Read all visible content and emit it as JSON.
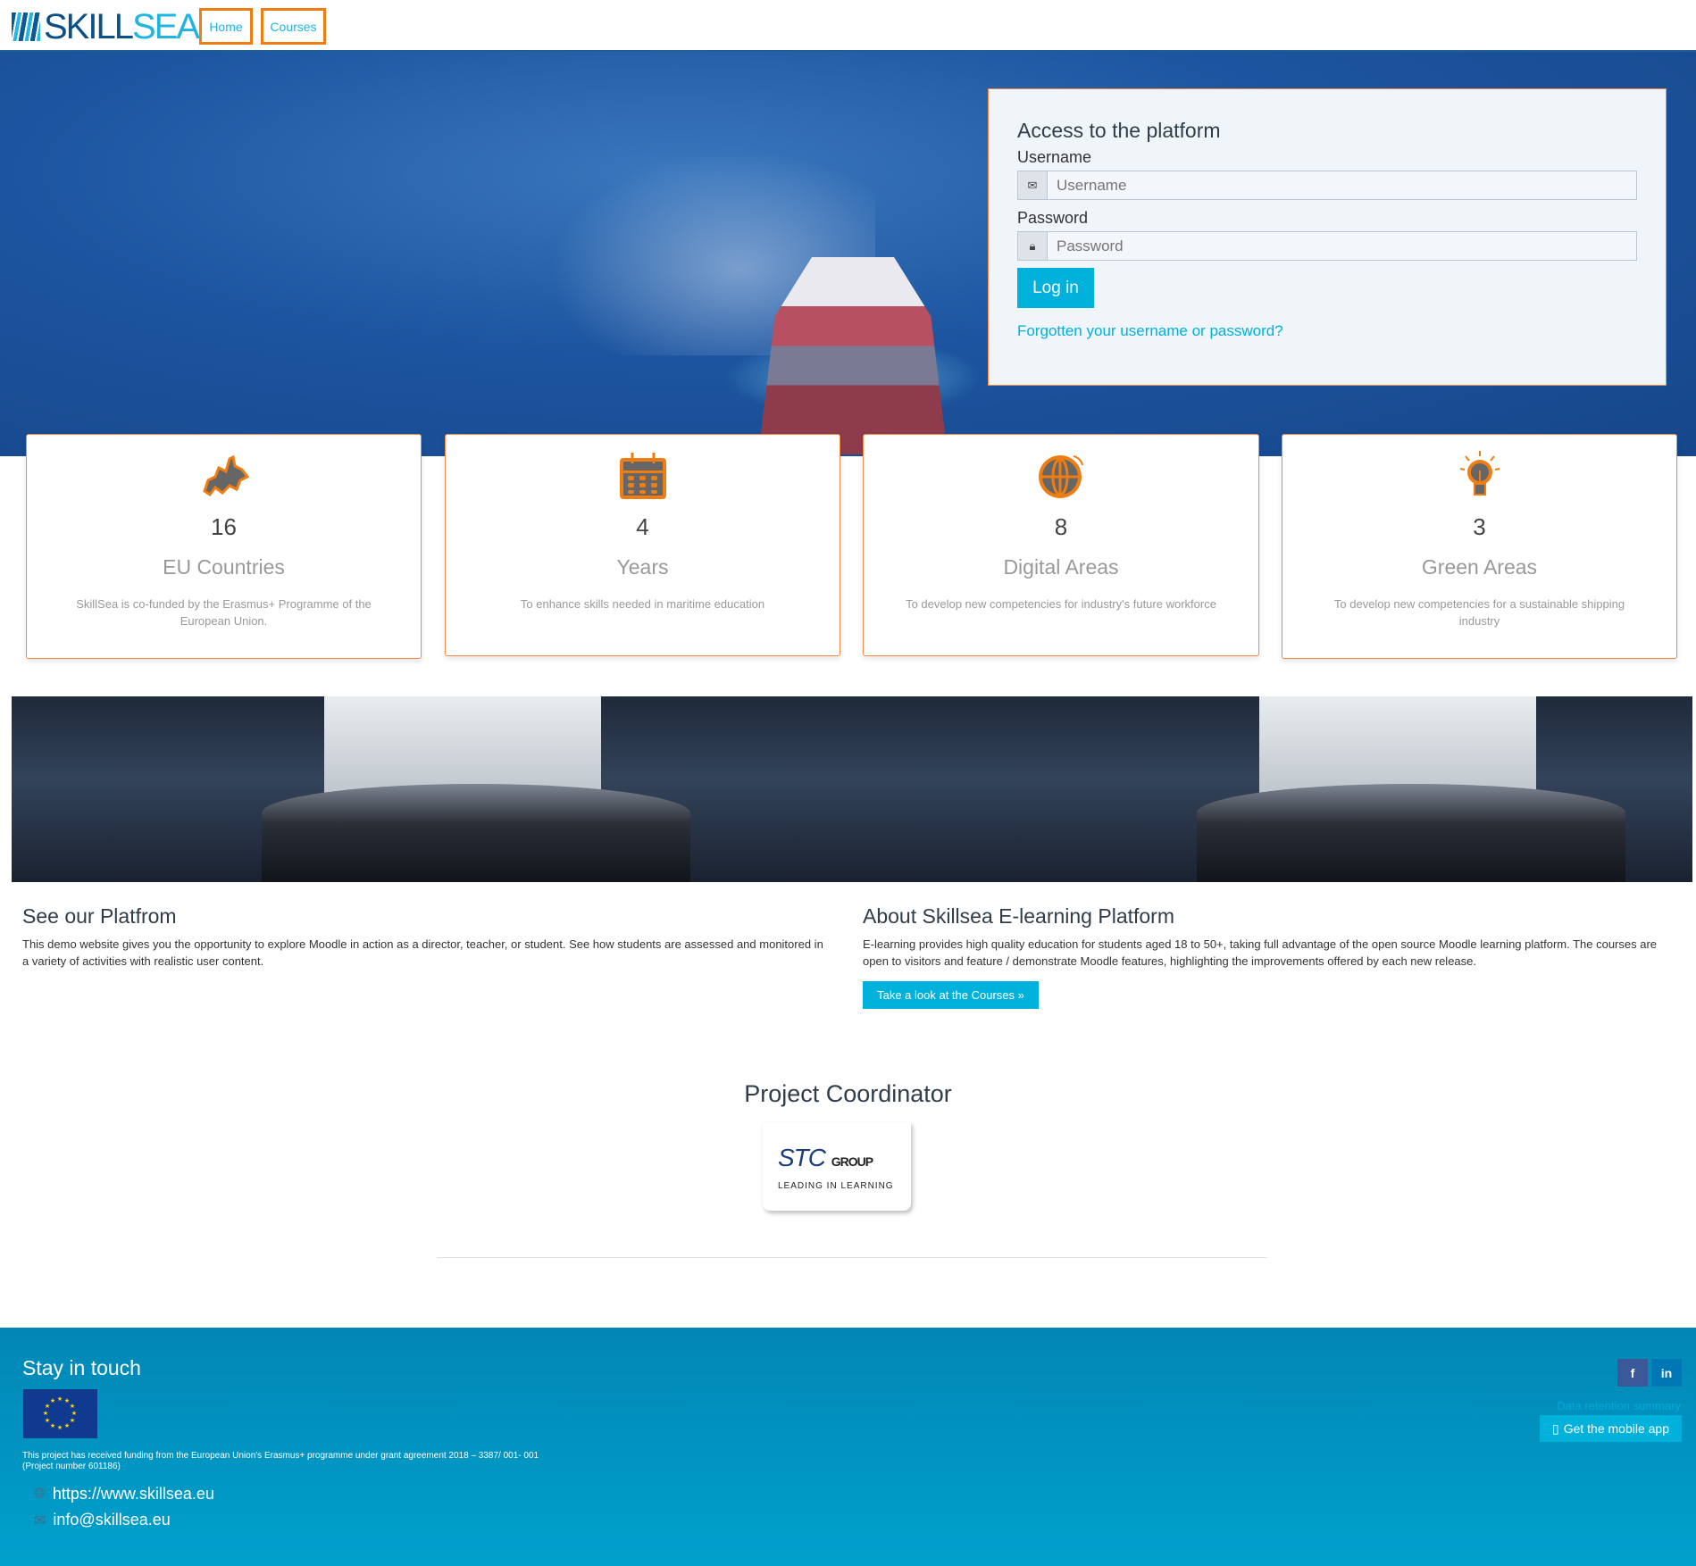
{
  "header": {
    "logo": "SKILLSEA",
    "logo_part1": "SKILL",
    "logo_part2": "SEA",
    "nav": [
      {
        "label": "Home"
      },
      {
        "label": "Courses"
      }
    ]
  },
  "login": {
    "title": "Access to the platform",
    "username_label": "Username",
    "username_placeholder": "Username",
    "password_label": "Password",
    "password_placeholder": "Password",
    "login_button": "Log in",
    "forgot_link": "Forgotten your username or password?"
  },
  "stats": [
    {
      "icon": "europe-map-icon",
      "number": "16",
      "title": "EU Countries",
      "desc": "SkillSea is co-funded by the Erasmus+ Programme of the European Union."
    },
    {
      "icon": "calendar-icon",
      "number": "4",
      "title": "Years",
      "desc": "To enhance skills needed in maritime education"
    },
    {
      "icon": "globe-icon",
      "number": "8",
      "title": "Digital Areas",
      "desc": "To develop new competencies for industry's future workforce"
    },
    {
      "icon": "lightbulb-icon",
      "number": "3",
      "title": "Green Areas",
      "desc": "To develop new competencies for a sustainable shipping industry"
    }
  ],
  "platform": {
    "title": "See our Platfrom",
    "text": "This demo website gives you the opportunity to explore Moodle in action as a director, teacher, or student. See how students are assessed and monitored in a variety of activities with realistic user content."
  },
  "about": {
    "title": "About Skillsea E-learning Platform",
    "text": "E-learning provides high quality education for students aged 18 to 50+, taking full advantage of the open source Moodle learning platform. The courses are open to visitors and feature / demonstrate Moodle features, highlighting the improvements offered by each new release.",
    "button": "Take a look at the Courses »"
  },
  "coordinator": {
    "title": "Project Coordinator",
    "logo_text": "STC GROUP",
    "logo_tagline": "LEADING IN LEARNING"
  },
  "footer": {
    "title": "Stay in touch",
    "funding": "This project has received funding from the European Union's Erasmus+ programme under grant agreement 2018 – 3387/ 001- 001",
    "project_number": "(Project number 601186)",
    "website": "https://www.skillsea.eu",
    "email": "info@skillsea.eu",
    "data_retention": "Data retention summary",
    "mobile_app": "Get the mobile app",
    "social": [
      {
        "icon": "facebook-icon",
        "label": "f",
        "color": "#3b5998"
      },
      {
        "icon": "linkedin-icon",
        "label": "in",
        "color": "#0077b5"
      }
    ]
  },
  "colors": {
    "accent": "#00b1dc",
    "border_orange": "#f07d12",
    "footer_bg": "#0286b5"
  }
}
